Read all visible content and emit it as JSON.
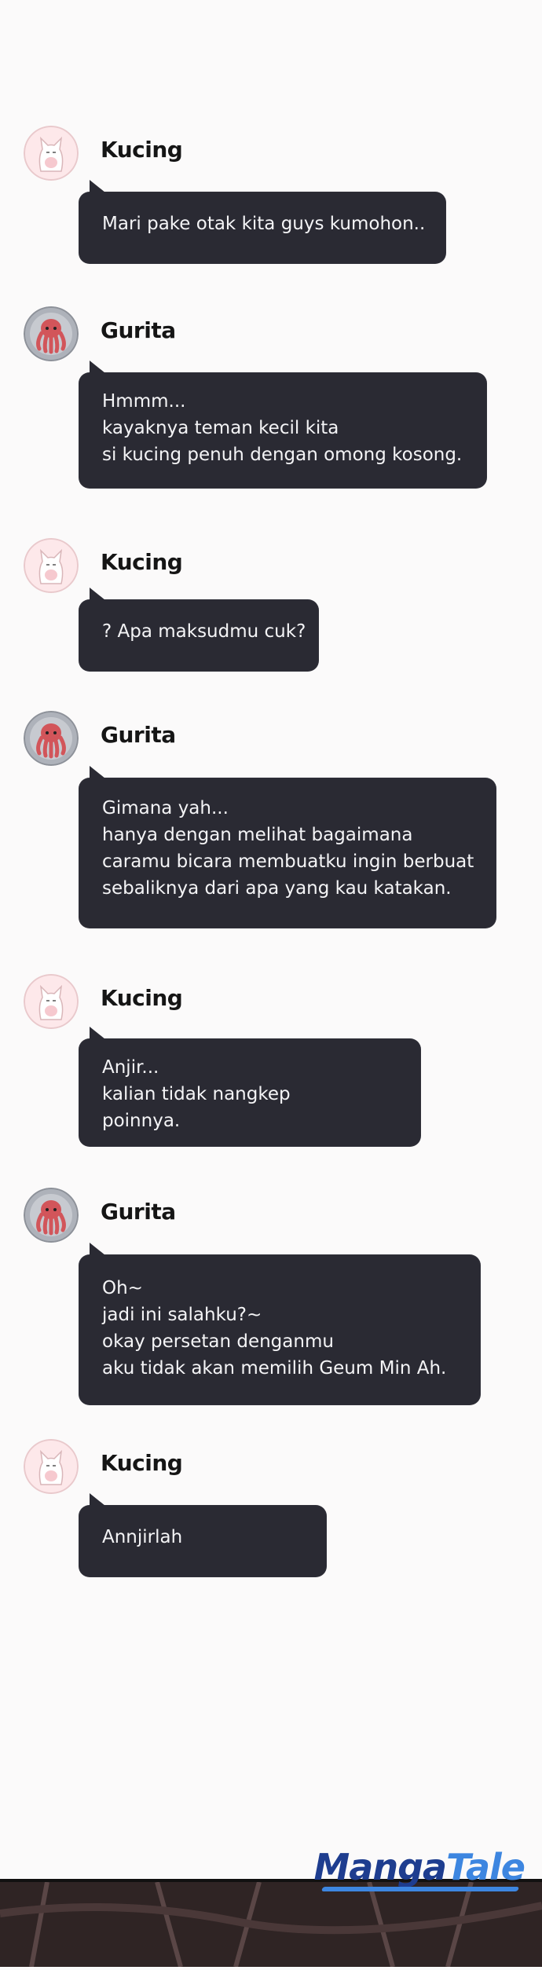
{
  "speakers": {
    "cat": {
      "name": "Kucing",
      "avatar_icon": "cat-avatar-icon"
    },
    "octopus": {
      "name": "Gurita",
      "avatar_icon": "octopus-avatar-icon"
    }
  },
  "messages": [
    {
      "speaker": "Kucing",
      "lines": [
        "Mari pake otak kita guys kumohon.."
      ]
    },
    {
      "speaker": "Gurita",
      "lines": [
        "Hmmm...",
        "kayaknya teman kecil kita",
        "si kucing penuh dengan omong kosong."
      ]
    },
    {
      "speaker": "Kucing",
      "lines": [
        "? Apa maksudmu cuk?"
      ]
    },
    {
      "speaker": "Gurita",
      "lines": [
        "Gimana yah...",
        "hanya dengan melihat bagaimana",
        "caramu bicara membuatku ingin berbuat",
        "sebaliknya dari apa yang kau katakan."
      ]
    },
    {
      "speaker": "Kucing",
      "lines": [
        "Anjir...",
        "kalian tidak nangkep",
        "poinnya."
      ]
    },
    {
      "speaker": "Gurita",
      "lines": [
        "Oh~",
        "jadi ini salahku?~",
        "okay persetan denganmu",
        "aku tidak akan memilih Geum Min Ah."
      ]
    },
    {
      "speaker": "Kucing",
      "lines": [
        "Annjirlah"
      ]
    }
  ],
  "watermark": {
    "part1": "Manga",
    "part2": "Tale"
  },
  "colors": {
    "bubble": "#2a2a33",
    "bubble_text": "#f4f4f6",
    "background": "#fbfafa",
    "logo_dark": "#1e3d8f",
    "logo_light": "#3d86e0"
  }
}
